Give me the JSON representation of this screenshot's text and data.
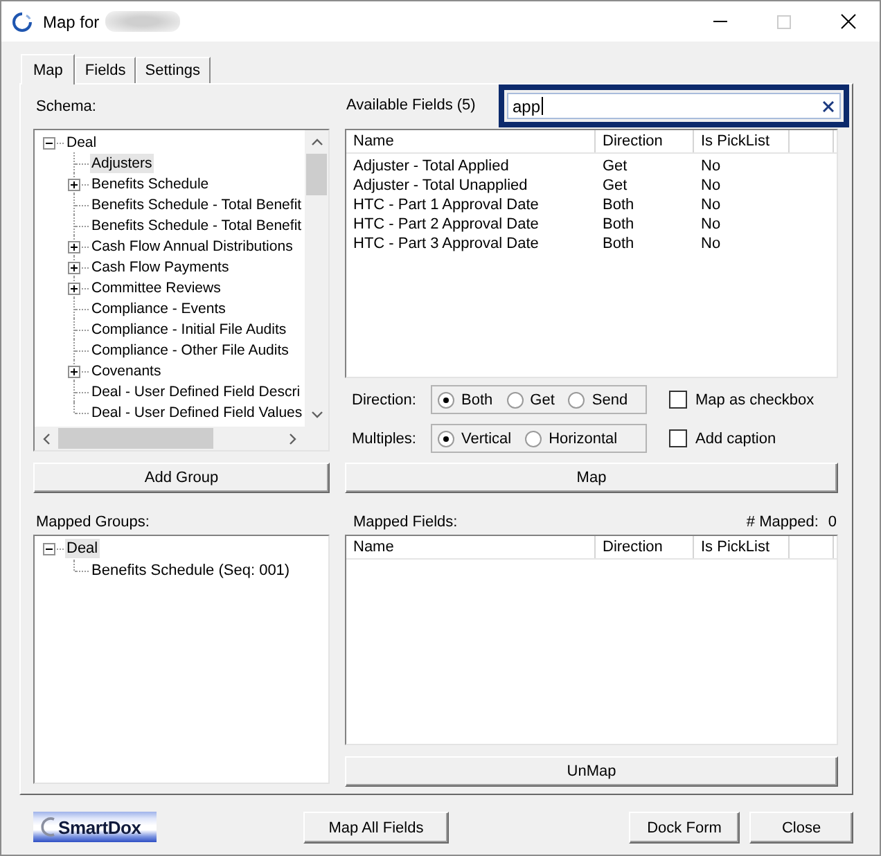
{
  "window": {
    "title": "Map for",
    "title_redacted": true,
    "maximize_disabled": true
  },
  "tabs": [
    {
      "label": "Map",
      "selected": true
    },
    {
      "label": "Fields",
      "selected": false
    },
    {
      "label": "Settings",
      "selected": false
    }
  ],
  "schema": {
    "label": "Schema:",
    "tree": [
      {
        "label": "Deal",
        "kind": "branch",
        "expanded": true,
        "selected": false,
        "children": [
          {
            "label": "Adjusters",
            "kind": "leaf",
            "selected": true
          },
          {
            "label": "Benefits Schedule",
            "kind": "branch",
            "expanded": false,
            "selected": false
          },
          {
            "label": "Benefits Schedule - Total Benefit",
            "kind": "leaf",
            "selected": false
          },
          {
            "label": "Benefits Schedule - Total Benefit",
            "kind": "leaf",
            "selected": false
          },
          {
            "label": "Cash Flow Annual Distributions",
            "kind": "branch",
            "expanded": false,
            "selected": false
          },
          {
            "label": "Cash Flow Payments",
            "kind": "branch",
            "expanded": false,
            "selected": false
          },
          {
            "label": "Committee Reviews",
            "kind": "branch",
            "expanded": false,
            "selected": false
          },
          {
            "label": "Compliance - Events",
            "kind": "leaf",
            "selected": false
          },
          {
            "label": "Compliance - Initial File Audits",
            "kind": "leaf",
            "selected": false
          },
          {
            "label": "Compliance - Other File Audits",
            "kind": "leaf",
            "selected": false
          },
          {
            "label": "Covenants",
            "kind": "branch",
            "expanded": false,
            "selected": false
          },
          {
            "label": "Deal - User Defined Field Descri",
            "kind": "leaf",
            "selected": false
          },
          {
            "label": "Deal - User Defined Field Values",
            "kind": "leaf",
            "selected": false
          }
        ]
      }
    ],
    "button": "Add Group"
  },
  "available_fields": {
    "label": "Available Fields (5)",
    "search": {
      "value": "app",
      "focused": true,
      "highlighted": true
    },
    "columns": [
      "Name",
      "Direction",
      "Is PickList"
    ],
    "rows": [
      [
        "Adjuster - Total Applied",
        "Get",
        "No"
      ],
      [
        "Adjuster - Total Unapplied",
        "Get",
        "No"
      ],
      [
        "HTC - Part 1 Approval Date",
        "Both",
        "No"
      ],
      [
        "HTC - Part 2 Approval Date",
        "Both",
        "No"
      ],
      [
        "HTC - Part 3 Approval Date",
        "Both",
        "No"
      ]
    ],
    "button": "Map"
  },
  "options": [
    {
      "label": "Direction:",
      "choices": [
        {
          "label": "Both",
          "selected": true
        },
        {
          "label": "Get",
          "selected": false
        },
        {
          "label": "Send",
          "selected": false
        }
      ],
      "checkbox": {
        "label": "Map as checkbox",
        "checked": false
      }
    },
    {
      "label": "Multiples:",
      "choices": [
        {
          "label": "Vertical",
          "selected": true
        },
        {
          "label": "Horizontal",
          "selected": false
        }
      ],
      "checkbox": {
        "label": "Add caption",
        "checked": false
      }
    }
  ],
  "mapped_groups": {
    "label": "Mapped Groups:",
    "tree": [
      {
        "label": "Deal",
        "kind": "branch",
        "expanded": true,
        "selected": true,
        "children": [
          {
            "label": "Benefits Schedule (Seq: 001)",
            "kind": "leaf",
            "selected": false
          }
        ]
      }
    ]
  },
  "mapped_fields": {
    "label": "Mapped Fields:",
    "count_label": "# Mapped:",
    "count": "0",
    "columns": [
      "Name",
      "Direction",
      "Is PickList"
    ],
    "button": "UnMap"
  },
  "footer": {
    "logo": "SmartDox",
    "left_buttons": [
      "Map All Fields"
    ],
    "right_buttons": [
      "Dock Form",
      "Close"
    ]
  }
}
